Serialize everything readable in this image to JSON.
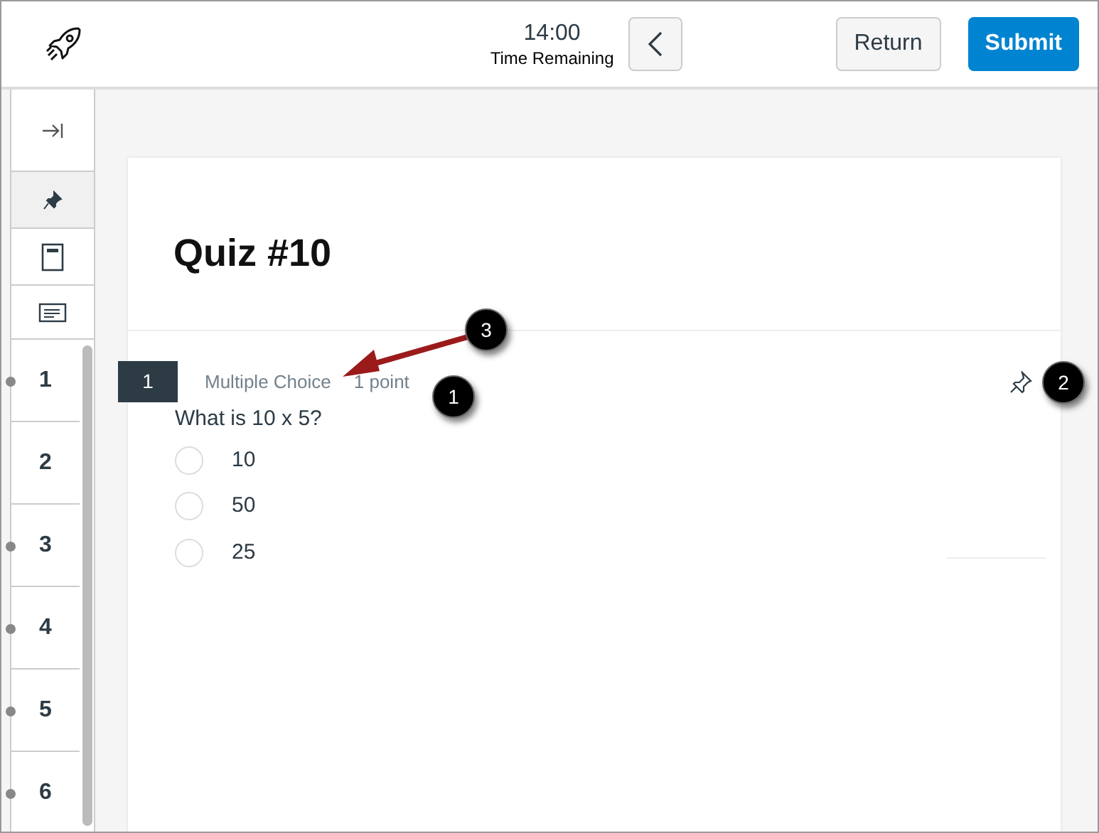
{
  "header": {
    "timer": "14:00",
    "timer_label": "Time Remaining",
    "buttons": [
      {
        "label": "Return",
        "kind": "secondary"
      },
      {
        "label": "Submit",
        "kind": "primary"
      }
    ]
  },
  "sidebar": {
    "tools": [
      {
        "kind": "collapse",
        "selected": false
      },
      {
        "kind": "pin",
        "selected": true
      },
      {
        "kind": "calculator",
        "selected": false
      },
      {
        "kind": "notes",
        "selected": false
      }
    ],
    "questions": [
      {
        "label": "1",
        "marked": true
      },
      {
        "label": "2",
        "marked": false
      },
      {
        "label": "3",
        "marked": true
      },
      {
        "label": "4",
        "marked": true
      },
      {
        "label": "5",
        "marked": true
      },
      {
        "label": "6",
        "marked": true
      }
    ]
  },
  "quiz": {
    "title": "Quiz #10",
    "question": {
      "number": "1",
      "type": "Multiple Choice",
      "points": "1 point",
      "text": "What is 10 x 5?",
      "options": [
        {
          "label": "10",
          "selected": false
        },
        {
          "label": "50",
          "selected": false
        },
        {
          "label": "25",
          "selected": false
        }
      ]
    }
  },
  "callouts": [
    "1",
    "2",
    "3"
  ]
}
